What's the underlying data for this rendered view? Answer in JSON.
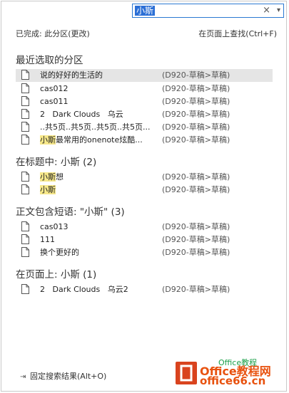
{
  "search": {
    "value": "小斯",
    "clear_icon": "×",
    "dropdown_icon": "▾"
  },
  "status": "已完成: 此分区(更改)",
  "find_on_page": "在页面上查找(Ctrl+F)",
  "sections": [
    {
      "title": "最近选取的分区",
      "items": [
        {
          "name": "说的好好的生活的",
          "location": "(D920-草稿>草稿)",
          "selected": true
        },
        {
          "name": "cas012",
          "location": "(D920-草稿>草稿)"
        },
        {
          "name": "cas011",
          "location": "(D920-草稿>草稿)"
        },
        {
          "name": "2   Dark Clouds   乌云",
          "location": "(D920-草稿>草稿)"
        },
        {
          "name": "..共5页..共5页..共5页..共5页...",
          "location": "(D920-草稿>草稿)"
        },
        {
          "name_hl": "小斯",
          "name_rest": "最常用的onenote炫酷...",
          "location": "(D920-草稿>草稿)"
        }
      ]
    },
    {
      "title": "在标题中: 小斯 (2)",
      "items": [
        {
          "name_hl": "小斯",
          "name_rest": "想",
          "location": "(D920-草稿>草稿)"
        },
        {
          "name_hl": "小斯",
          "name_rest": "",
          "location": "(D920-草稿>草稿)"
        }
      ]
    },
    {
      "title": "正文包含短语: \"小斯\" (3)",
      "items": [
        {
          "name": "cas013",
          "location": "(D920-草稿>草稿)"
        },
        {
          "name": "111",
          "location": "(D920-草稿>草稿)"
        },
        {
          "name": "换个更好的",
          "location": "(D920-草稿>草稿)"
        }
      ]
    },
    {
      "title": "在页面上: 小斯 (1)",
      "items": [
        {
          "name": "2   Dark Clouds   乌云2",
          "location": "(D920-草稿>草稿)"
        }
      ]
    }
  ],
  "pin_label": "固定搜索结果(Alt+O)",
  "pin_icon": "pin-icon",
  "watermark": {
    "line1": "Office教程网",
    "line2": "office66.cn",
    "wechat": "Office教程"
  },
  "colors": {
    "accent": "#2b79d2",
    "highlight": "#f7e88a",
    "selected_row": "#e5e5e5",
    "brand": "#e8520f"
  }
}
